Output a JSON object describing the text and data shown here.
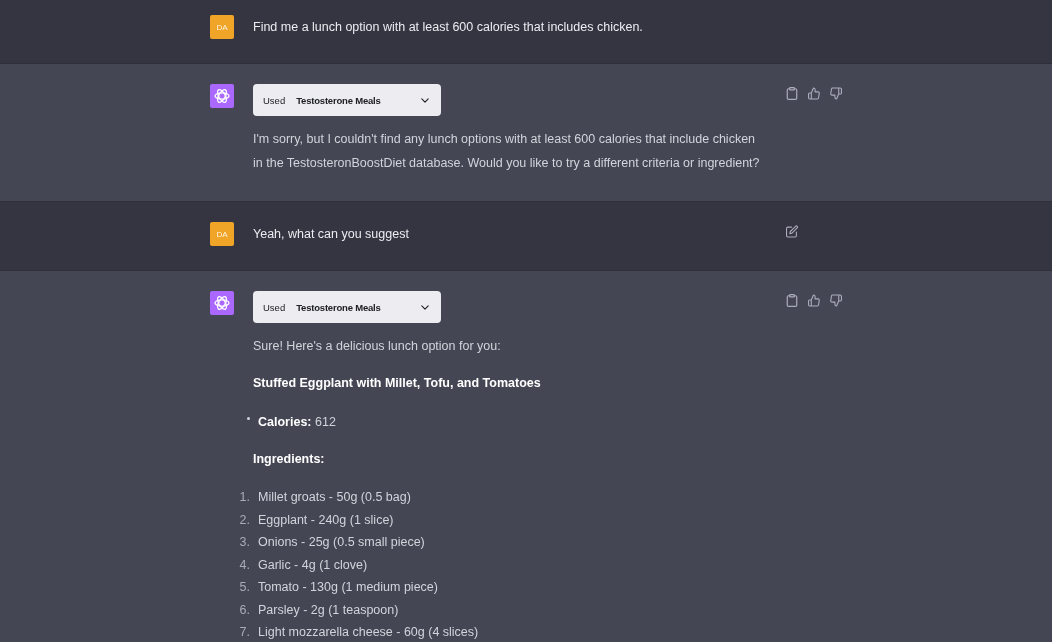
{
  "conversation": [
    {
      "kind": "user",
      "avatar": "DA",
      "text": "Find me a lunch option with at least 600 calories that includes chicken.",
      "edit_button": false
    },
    {
      "kind": "assistant",
      "plugin": {
        "prefix": "Used",
        "name": "Testosterone Meals",
        "expanded": false
      },
      "feedback_buttons": true,
      "blocks": [
        {
          "kind": "paragraph",
          "text": "I'm sorry, but I couldn't find any lunch options with at least 600 calories that include chicken in the TestosteronBoostDiet database. Would you like to try a different criteria or ingredient?"
        }
      ]
    },
    {
      "kind": "user",
      "avatar": "DA",
      "text": "Yeah, what can you suggest",
      "edit_button": true
    },
    {
      "kind": "assistant",
      "plugin": {
        "prefix": "Used",
        "name": "Testosterone Meals",
        "expanded": false
      },
      "feedback_buttons": true,
      "blocks": [
        {
          "kind": "paragraph",
          "text": "Sure! Here's a delicious lunch option for you:"
        },
        {
          "kind": "heading",
          "text": "Stuffed Eggplant with Millet, Tofu, and Tomatoes"
        },
        {
          "kind": "bullets",
          "items": [
            "**Calories:** 612"
          ]
        },
        {
          "kind": "heading",
          "text": "Ingredients:"
        },
        {
          "kind": "numbered",
          "items": [
            {
              "number": "1.",
              "text": "Millet groats - 50g (0.5 bag)"
            },
            {
              "number": "2.",
              "text": "Eggplant - 240g (1 slice)"
            },
            {
              "number": "3.",
              "text": "Onions - 25g (0.5 small piece)"
            },
            {
              "number": "4.",
              "text": "Garlic - 4g (1 clove)"
            },
            {
              "number": "5.",
              "text": "Tomato - 130g (1 medium piece)"
            },
            {
              "number": "6.",
              "text": "Parsley - 2g (1 teaspoon)"
            },
            {
              "number": "7.",
              "text": "Light mozzarella cheese - 60g (4 slices)"
            }
          ]
        }
      ]
    }
  ]
}
